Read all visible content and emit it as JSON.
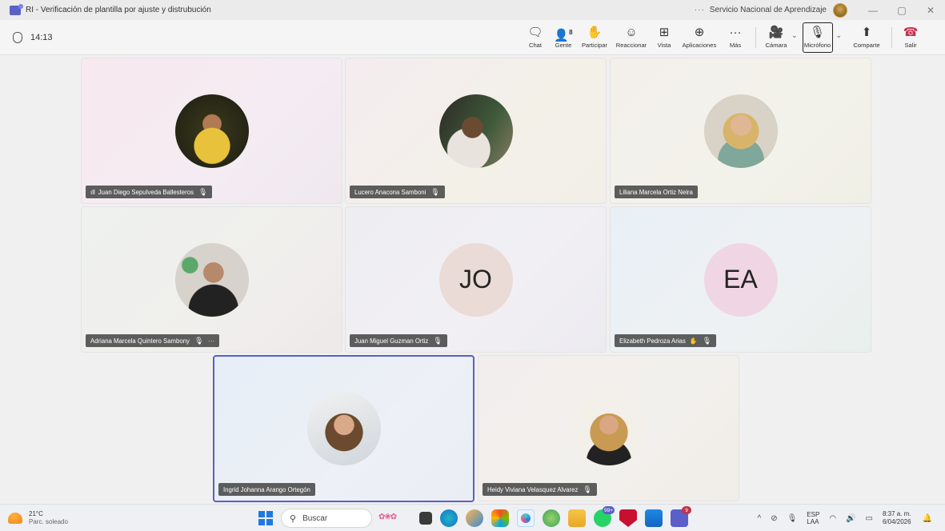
{
  "window": {
    "title": "RI - Verificación de plantilla por ajuste y distrubución",
    "dots": "···",
    "org": "Servicio Nacional de Aprendizaje"
  },
  "toolbar": {
    "timer": "14:13",
    "tools": {
      "chat": "Chat",
      "people": "Gente",
      "people_count": "8",
      "raise": "Participar",
      "react": "Reaccionar",
      "view": "Vista",
      "apps": "Aplicaciones",
      "more": "Más",
      "camera": "Cámara",
      "mic": "Micrófono",
      "share": "Comparte",
      "leave": "Salir"
    }
  },
  "participants": [
    {
      "name": "Juan Diego Sepulveda Ballesteros",
      "muted": true
    },
    {
      "name": "Lucero Anacona Samboni",
      "muted": true
    },
    {
      "name": "Liliana Marcela Ortiz Neira",
      "muted": false
    },
    {
      "name": "Adriana Marcela Quintero Sambony",
      "muted": true
    },
    {
      "name": "Juan Miguel Guzman Ortiz",
      "muted": true,
      "initials": "JO"
    },
    {
      "name": "Elizabeth Pedroza Arias",
      "muted": true,
      "initials": "EA"
    },
    {
      "name": "Ingrid Johanna Arango Ortegón",
      "muted": false
    },
    {
      "name": "Heidy Viviana Velasquez Alvarez",
      "muted": true
    }
  ],
  "taskbar": {
    "temp": "21°C",
    "weather": "Parc. soleado",
    "search_placeholder": "Buscar",
    "badge_whatsapp": "99+",
    "badge_teams": "9",
    "lang_top": "ESP",
    "lang_bottom": "LAA",
    "time": "8:37 a. m.",
    "date": "6/04/2026"
  },
  "colors": {
    "accent": "#5b5fc7",
    "leave": "#c4314b",
    "initials_jo_bg": "#eadbd6",
    "initials_ea_bg": "#f0d6e4"
  }
}
